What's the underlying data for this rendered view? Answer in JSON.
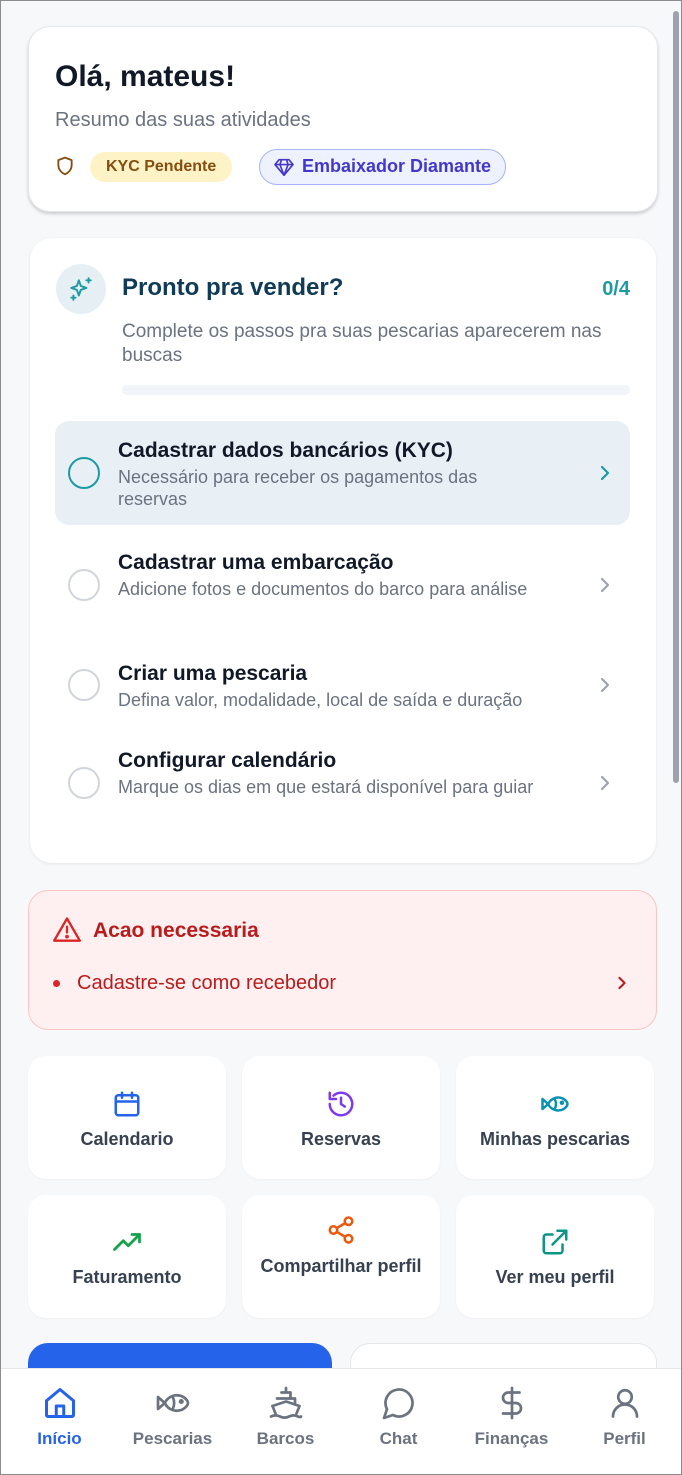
{
  "greeting": {
    "title": "Olá, mateus!",
    "subtitle": "Resumo das suas atividades",
    "kyc_badge": "KYC Pendente",
    "ambassador_badge": "Embaixador Diamante"
  },
  "onboarding": {
    "title": "Pronto pra vender?",
    "progress_text": "0/4",
    "progress_fraction": 0,
    "description": "Complete os passos pra suas pescarias aparecerem nas buscas",
    "steps": [
      {
        "title": "Cadastrar dados bancários (KYC)",
        "text": "Necessário para receber os pagamentos das reservas",
        "active": true
      },
      {
        "title": "Cadastrar uma embarcação",
        "text": "Adicione fotos e documentos do barco para análise",
        "active": false
      },
      {
        "title": "Criar uma pescaria",
        "text": "Defina valor, modalidade, local de saída e duração",
        "active": false
      },
      {
        "title": "Configurar calendário",
        "text": "Marque os dias em que estará disponível para guiar",
        "active": false
      }
    ]
  },
  "alert": {
    "title": "Acao necessaria",
    "item": "Cadastre-se como recebedor"
  },
  "quick_actions": [
    {
      "label": "Calendario",
      "icon": "calendar-icon",
      "color": "#2563eb"
    },
    {
      "label": "Reservas",
      "icon": "history-icon",
      "color": "#7c3aed"
    },
    {
      "label": "Minhas pescarias",
      "icon": "fish-icon",
      "color": "#0891b2"
    },
    {
      "label": "Faturamento",
      "icon": "trending-up-icon",
      "color": "#16a34a"
    },
    {
      "label": "Compartilhar perfil",
      "icon": "share-icon",
      "color": "#ea580c"
    },
    {
      "label": "Ver meu perfil",
      "icon": "external-link-icon",
      "color": "#0d9488"
    }
  ],
  "nav": [
    {
      "label": "Início",
      "icon": "home-icon",
      "active": true
    },
    {
      "label": "Pescarias",
      "icon": "fish-icon",
      "active": false
    },
    {
      "label": "Barcos",
      "icon": "ship-icon",
      "active": false
    },
    {
      "label": "Chat",
      "icon": "chat-icon",
      "active": false
    },
    {
      "label": "Finanças",
      "icon": "dollar-icon",
      "active": false
    },
    {
      "label": "Perfil",
      "icon": "user-icon",
      "active": false
    }
  ],
  "colors": {
    "primary": "#2563eb",
    "teal": "#1e9aa3",
    "danger": "#b91c1c",
    "warning_bg": "#fef3c7"
  }
}
